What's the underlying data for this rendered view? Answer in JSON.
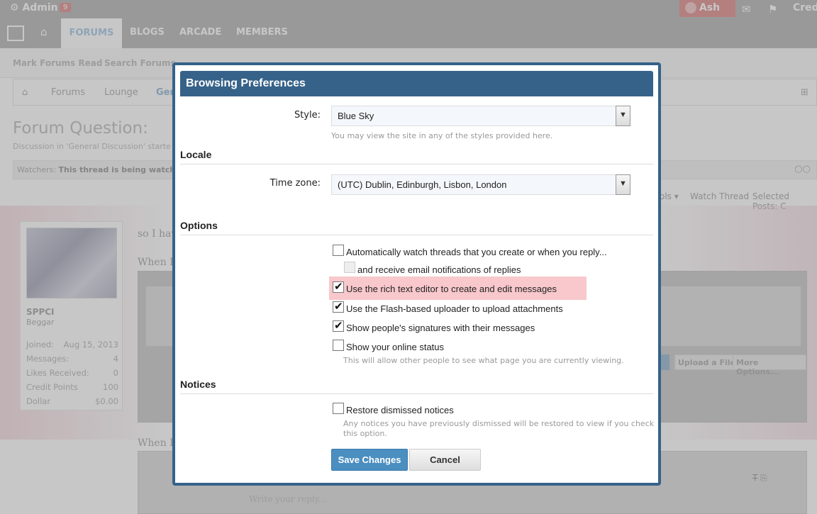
{
  "adminbar": {
    "admin_label": "Admin",
    "badge": "9",
    "user": "Ash",
    "credits": "Cred"
  },
  "nav": {
    "tabs": [
      "FORUMS",
      "BLOGS",
      "ARCADE",
      "MEMBERS"
    ]
  },
  "subnav": {
    "items": [
      "Mark Forums Read",
      "Search Forums"
    ]
  },
  "breadcrumb": {
    "items": [
      "Forums",
      "Lounge",
      "Gen"
    ]
  },
  "page": {
    "title": "Forum Question:",
    "description": "Discussion in 'General Discussion' starte",
    "watch_prefix": "Watchers:",
    "watch_text": "This thread is being watched b"
  },
  "thread_tools": {
    "tools": "ols ▾",
    "watch": "Watch Thread",
    "selected": "Selected Posts: C"
  },
  "user": {
    "name": "SPPCI",
    "title": "Beggar",
    "stats": [
      {
        "label": "Joined:",
        "value": "Aug 15, 2013"
      },
      {
        "label": "Messages:",
        "value": "4"
      },
      {
        "label": "Likes Received:",
        "value": "0"
      },
      {
        "label": "Credit Points",
        "value": "100"
      },
      {
        "label": "Dollar",
        "value": "$0.00"
      }
    ]
  },
  "post": {
    "line1": "so I hav",
    "line2": "When I",
    "line3": "When I"
  },
  "editor": {
    "upload": "Upload a File",
    "more": "More Options...",
    "placeholder": "Write your reply..."
  },
  "modal": {
    "title": "Browsing Preferences",
    "style_label": "Style:",
    "style_value": "Blue Sky",
    "style_hint": "You may view the site in any of the styles provided here.",
    "locale_heading": "Locale",
    "timezone_label": "Time zone:",
    "timezone_value": "(UTC) Dublin, Edinburgh, Lisbon, London",
    "options_heading": "Options",
    "options": [
      {
        "label": "Automatically watch threads that you create or when you reply...",
        "checked": false
      },
      {
        "label": "and receive email notifications of replies",
        "checked": false
      },
      {
        "label": "Use the rich text editor to create and edit messages",
        "checked": true
      },
      {
        "label": "Use the Flash-based uploader to upload attachments",
        "checked": true
      },
      {
        "label": "Show people's signatures with their messages",
        "checked": true
      },
      {
        "label": "Show your online status",
        "checked": false
      }
    ],
    "online_hint": "This will allow other people to see what page you are currently viewing.",
    "notices_heading": "Notices",
    "restore_label": "Restore dismissed notices",
    "restore_hint_1": "Any notices you have previously dismissed will be restored to view if you check",
    "restore_hint_2": "this option.",
    "save_label": "Save Changes",
    "cancel_label": "Cancel"
  },
  "colors": {
    "modal_accent": "#366289",
    "highlight": "#f8c8cc",
    "save_button": "#4b8ec0"
  }
}
